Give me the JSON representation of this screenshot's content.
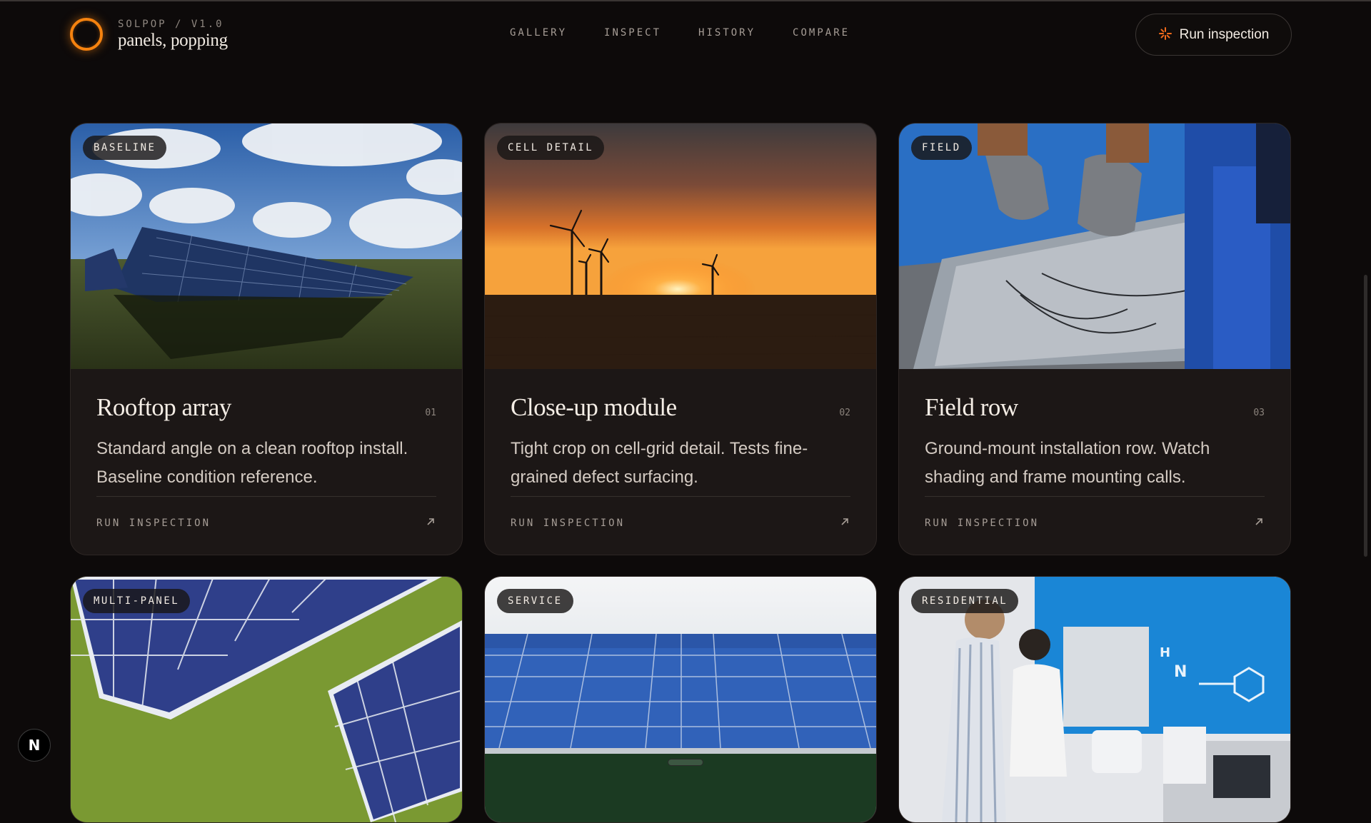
{
  "brand": {
    "version": "SOLPOP / V1.0",
    "tagline": "panels, popping"
  },
  "nav": {
    "items": [
      "GALLERY",
      "INSPECT",
      "HISTORY",
      "COMPARE"
    ]
  },
  "header": {
    "run_button_label": "Run inspection"
  },
  "cards": [
    {
      "badge": "BASELINE",
      "title": "Rooftop array",
      "number": "01",
      "description": "Standard angle on a clean rooftop install. Baseline condition reference.",
      "cta": "RUN INSPECTION",
      "image": "solar-field-cloudy-sky"
    },
    {
      "badge": "CELL DETAIL",
      "title": "Close-up module",
      "number": "02",
      "description": "Tight crop on cell-grid detail. Tests fine-grained defect surfacing.",
      "cta": "RUN INSPECTION",
      "image": "wind-turbines-sunset"
    },
    {
      "badge": "FIELD",
      "title": "Field row",
      "number": "03",
      "description": "Ground-mount installation row. Watch shading and frame mounting calls.",
      "cta": "RUN INSPECTION",
      "image": "gloved-hands-installing-panel"
    },
    {
      "badge": "MULTI-PANEL",
      "image": "aerial-panels-on-grass"
    },
    {
      "badge": "SERVICE",
      "image": "panel-row-under-sky"
    },
    {
      "badge": "RESIDENTIAL",
      "image": "lab-researchers"
    }
  ],
  "colors": {
    "accent": "#f5820f",
    "card_bg": "#1c1716",
    "page_bg": "#0d0a0a"
  },
  "icons": {
    "run_button": "spark-icon",
    "cta": "arrow-up-right-icon",
    "framework_badge": "n-logo-icon"
  },
  "framework_badge": "N"
}
